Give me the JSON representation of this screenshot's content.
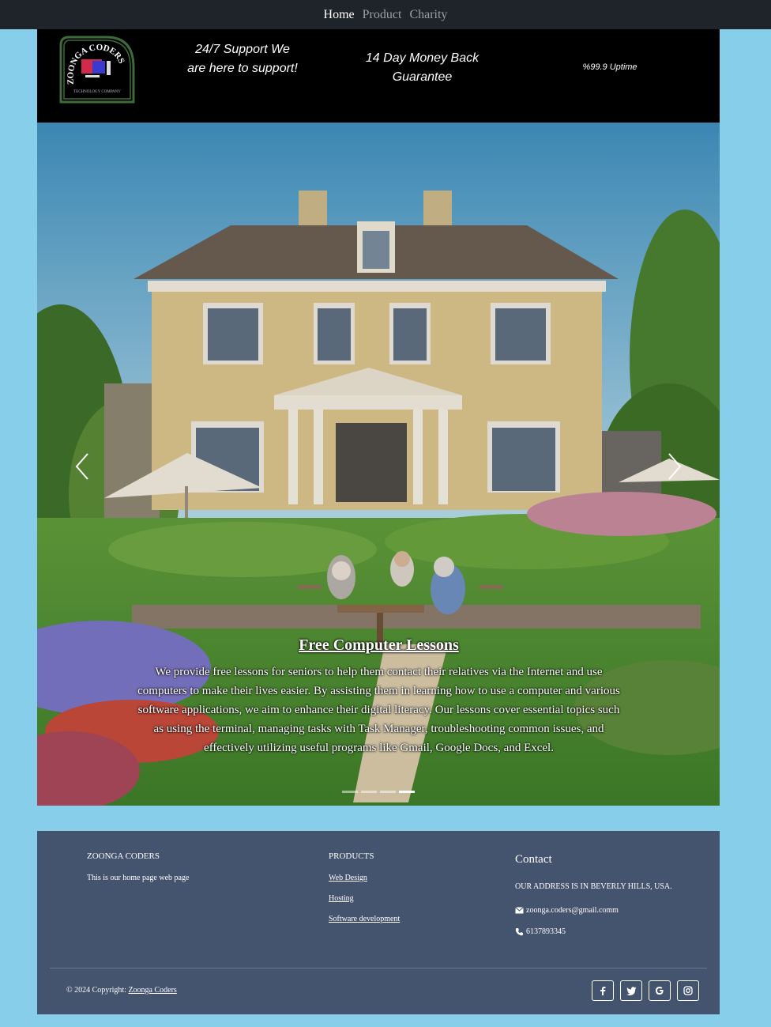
{
  "nav": {
    "items": [
      {
        "label": "Home",
        "active": true
      },
      {
        "label": "Product",
        "active": false
      },
      {
        "label": "Charity",
        "active": false
      }
    ]
  },
  "header": {
    "logo": {
      "brand": "ZOONGA CODERS",
      "tagline": "TECHNOLOGY COMPANY",
      "icon": "computer-monitor-logo"
    },
    "features": [
      "24/7 Support We are here to support!",
      "14 Day Money Back Guarantee",
      "%99.9 Uptime"
    ]
  },
  "carousel": {
    "slide_title": "Free Computer Lessons",
    "slide_text": "We provide free lessons for seniors to help them contact their relatives via the Internet and use computers to make their lives easier. By assisting them in learning how to use a computer and various software applications, we aim to enhance their digital literacy. Our lessons cover essential topics such as using the terminal, managing tasks with Task Manager, troubleshooting common issues, and effectively utilizing useful programs like Gmail, Google Docs, and Excel.",
    "indicator_count": 4,
    "active_indicator": 4,
    "prev_icon": "chevron-left-icon",
    "next_icon": "chevron-right-icon"
  },
  "footer": {
    "about": {
      "heading": "ZOONGA CODERS",
      "text": "This is our home page web page"
    },
    "products": {
      "heading": "PRODUCTS",
      "links": [
        "Web Design",
        "Hosting",
        "Software development"
      ]
    },
    "contact": {
      "heading": "Contact",
      "address": "OUR ADDRESS IS IN BEVERLY HILLS, USA.",
      "email": "zoonga.coders@gmail.comm",
      "phone": "6137893345"
    },
    "copyright_prefix": "© 2024 Copyright: ",
    "copyright_link": "Zoonga Coders",
    "socials": [
      "facebook-icon",
      "twitter-icon",
      "google-icon",
      "instagram-icon"
    ]
  },
  "colors": {
    "page_bg": "#87ceeb",
    "nav_bg": "#1f232a",
    "header_bg": "#000000",
    "footer_bg": "#44536e"
  }
}
